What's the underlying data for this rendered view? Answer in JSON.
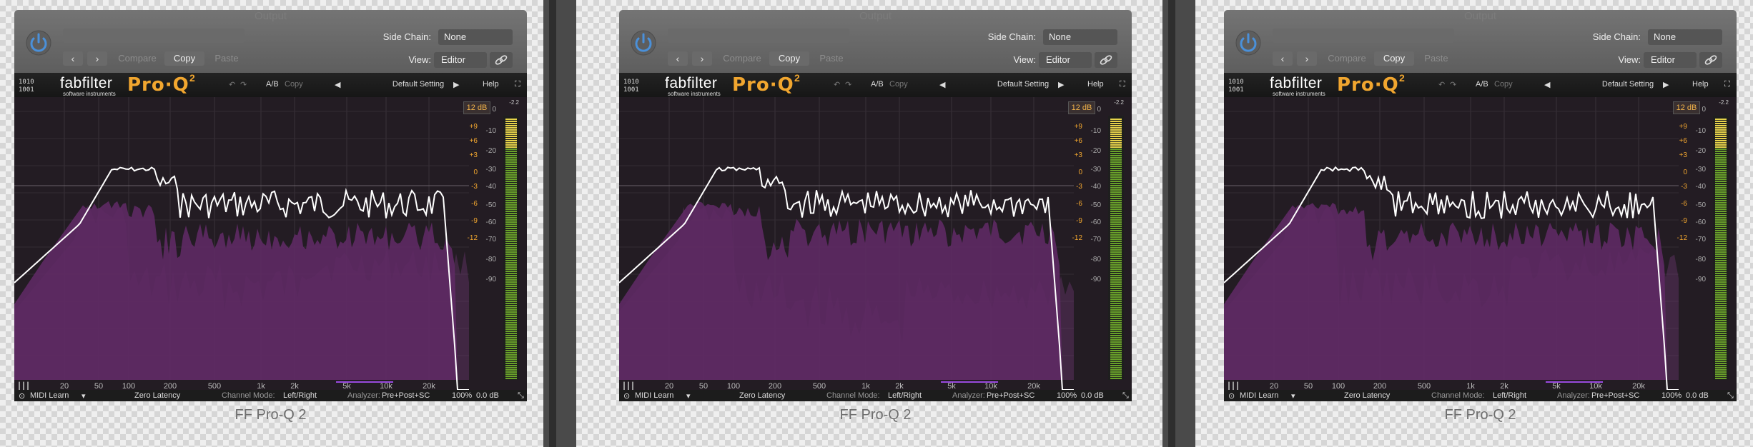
{
  "panels": [
    {
      "title": "Output",
      "side_chain_label": "Side Chain:",
      "side_chain_value": "None",
      "view_label": "View:",
      "view_value": "Editor",
      "compare_label": "Compare",
      "copy_label": "Copy",
      "paste_label": "Paste",
      "brand": "fabfilter",
      "brand_sub": "software instruments",
      "product": "Pro·Q",
      "product_sup": "2",
      "ab_label": "A/B",
      "bar_copy_label": "Copy",
      "preset_name": "Default Setting",
      "help_label": "Help",
      "range_badge": "12 dB",
      "footer": {
        "midi": "MIDI Learn",
        "latency": "Zero Latency",
        "channel_mode_label": "Channel Mode:",
        "channel_mode_value": "Left/Right",
        "analyzer_label": "Analyzer:",
        "analyzer_value": "Pre+Post+SC",
        "zoom": "100%",
        "gain": "0.0 dB"
      },
      "plugin_title": "FF Pro-Q 2"
    },
    {
      "title": "Output",
      "side_chain_label": "Side Chain:",
      "side_chain_value": "None",
      "view_label": "View:",
      "view_value": "Editor",
      "compare_label": "Compare",
      "copy_label": "Copy",
      "paste_label": "Paste",
      "brand": "fabfilter",
      "brand_sub": "software instruments",
      "product": "Pro·Q",
      "product_sup": "2",
      "ab_label": "A/B",
      "bar_copy_label": "Copy",
      "preset_name": "Default Setting",
      "help_label": "Help",
      "range_badge": "12 dB",
      "footer": {
        "midi": "MIDI Learn",
        "latency": "Zero Latency",
        "channel_mode_label": "Channel Mode:",
        "channel_mode_value": "Left/Right",
        "analyzer_label": "Analyzer:",
        "analyzer_value": "Pre+Post+SC",
        "zoom": "100%",
        "gain": "0.0 dB"
      },
      "plugin_title": "FF Pro-Q 2"
    },
    {
      "title": "Output",
      "side_chain_label": "Side Chain:",
      "side_chain_value": "None",
      "view_label": "View:",
      "view_value": "Editor",
      "compare_label": "Compare",
      "copy_label": "Copy",
      "paste_label": "Paste",
      "brand": "fabfilter",
      "brand_sub": "software instruments",
      "product": "Pro·Q",
      "product_sup": "2",
      "ab_label": "A/B",
      "bar_copy_label": "Copy",
      "preset_name": "Default Setting",
      "help_label": "Help",
      "range_badge": "12 dB",
      "footer": {
        "midi": "MIDI Learn",
        "latency": "Zero Latency",
        "channel_mode_label": "Channel Mode:",
        "channel_mode_value": "Left/Right",
        "analyzer_label": "Analyzer:",
        "analyzer_value": "Pre+Post+SC",
        "zoom": "100%",
        "gain": "0.0 dB"
      },
      "plugin_title": "FF Pro-Q 2"
    }
  ],
  "freq_labels": [
    "20",
    "50",
    "100",
    "200",
    "500",
    "1k",
    "2k",
    "5k",
    "10k",
    "20k"
  ],
  "eq_scale": [
    "+9",
    "+6",
    "+3",
    "0",
    "-3",
    "-6",
    "-9",
    "-12"
  ],
  "analyzer_scale": [
    "0",
    "-10",
    "-20",
    "-30",
    "-40",
    "-50",
    "-60",
    "-70",
    "-80",
    "-90"
  ],
  "meter_top_label": "-2.2",
  "colors": {
    "spectrum_fill": "#5e2a64",
    "spectrum_light": "#8a4a8e",
    "curve": "#ffffff",
    "accent": "#f1a62f",
    "meter_green": "#6aa22a",
    "meter_yellow": "#e6d34a",
    "power_blue": "#4a90d9"
  }
}
